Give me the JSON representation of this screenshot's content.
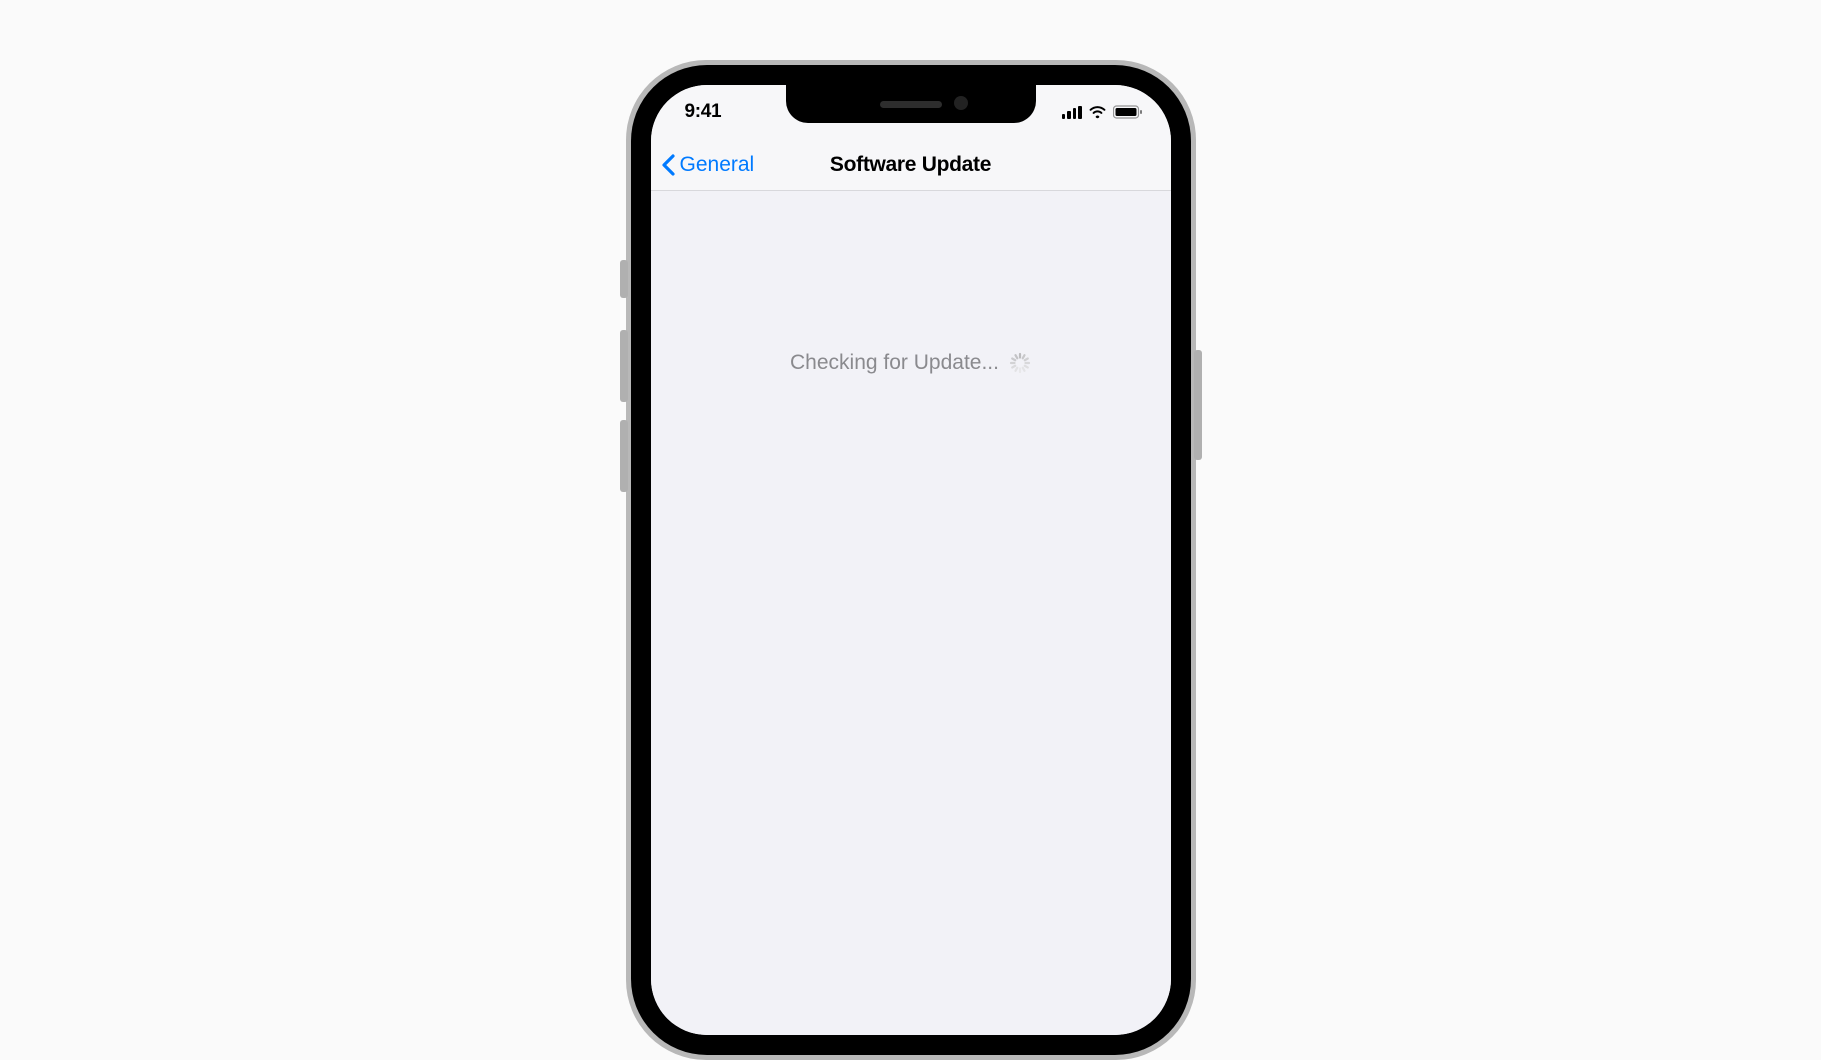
{
  "status_bar": {
    "time": "9:41"
  },
  "nav": {
    "back_label": "General",
    "title": "Software Update"
  },
  "content": {
    "status_text": "Checking for Update..."
  },
  "colors": {
    "tint": "#007aff",
    "background": "#f2f2f7",
    "nav_background": "#f7f7f9",
    "text_primary": "#000000",
    "text_secondary": "#8a8a8e"
  }
}
